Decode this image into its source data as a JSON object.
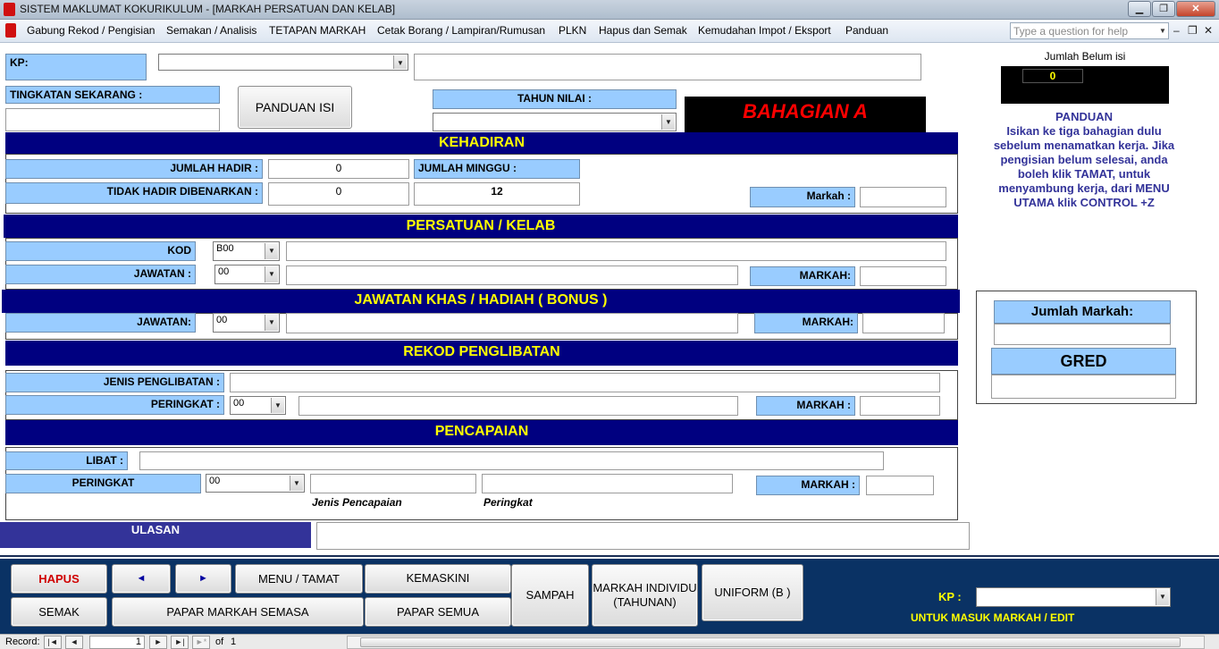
{
  "window": {
    "title": "SISTEM MAKLUMAT KOKURIKULUM - [MARKAH PERSATUAN DAN KELAB]"
  },
  "menu": [
    "Gabung Rekod / Pengisian",
    "Semakan / Analisis",
    "TETAPAN MARKAH",
    "Cetak Borang / Lampiran/Rumusan",
    "PLKN",
    "Hapus dan Semak",
    "Kemudahan Impot / Eksport",
    "Panduan"
  ],
  "help_placeholder": "Type a question for help",
  "header": {
    "kp_label": "KP:",
    "tingkatan_label": "TINGKATAN SEKARANG :",
    "panduan_isi_button": "PANDUAN ISI",
    "tahun_nilai_label": "TAHUN NILAI :",
    "bahagian_banner": "BAHAGIAN A"
  },
  "side": {
    "jumlah_belum_label": "Jumlah Belum isi",
    "jumlah_belum_value": "0",
    "panduan_title": "PANDUAN",
    "panduan_lines": [
      "Isikan ke tiga bahagian dulu",
      "sebelum menamatkan kerja. Jika",
      "pengisian belum selesai, anda",
      "boleh klik TAMAT, untuk",
      "menyambung kerja, dari MENU",
      "UTAMA klik CONTROL +Z"
    ],
    "jumlah_markah_label": "Jumlah Markah:",
    "gred_label": "GRED"
  },
  "kehadiran": {
    "title": "KEHADIRAN",
    "jumlah_hadir_label": "JUMLAH HADIR :",
    "jumlah_hadir_value": "0",
    "jumlah_minggu_label": "JUMLAH MINGGU :",
    "tidak_hadir_label": "TIDAK HADIR DIBENARKAN :",
    "tidak_hadir_value": "0",
    "minggu_value": "12",
    "markah_label": "Markah :"
  },
  "persatuan": {
    "title": "PERSATUAN / KELAB",
    "kod_label": "KOD",
    "kod_value": "B00",
    "jawatan_label": "JAWATAN :",
    "jawatan_value": "00",
    "markah_label": "MARKAH:"
  },
  "jawatan_khas": {
    "title": "JAWATAN KHAS / HADIAH ( BONUS )",
    "jawatan_label": "JAWATAN:",
    "jawatan_value": "00",
    "markah_label": "MARKAH:"
  },
  "penglibatan": {
    "title": "REKOD PENGLIBATAN",
    "jenis_label": "JENIS PENGLIBATAN :",
    "peringkat_label": "PERINGKAT :",
    "peringkat_value": "00",
    "markah_label": "MARKAH :"
  },
  "pencapaian": {
    "title": "PENCAPAIAN",
    "libat_label": "LIBAT :",
    "peringkat_label": "PERINGKAT",
    "peringkat_value": "00",
    "jenis_caption": "Jenis Pencapaian",
    "peringkat_caption": "Peringkat",
    "markah_label": "MARKAH :"
  },
  "ulasan_label": "ULASAN",
  "buttons": {
    "hapus": "HAPUS",
    "prev": "◄",
    "next": "►",
    "menu_tamat": "MENU / TAMAT",
    "kemaskini": "KEMASKINI",
    "sampah": "SAMPAH",
    "markah_individu": "MARKAH INDIVIDU (TAHUNAN)",
    "uniform": "UNIFORM (B )",
    "semak": "SEMAK",
    "papar_markah": "PAPAR MARKAH SEMASA",
    "papar_semua": "PAPAR SEMUA"
  },
  "bottom": {
    "kp_label": "KP :",
    "hint": "UNTUK MASUK MARKAH / EDIT"
  },
  "status": {
    "record_label": "Record:",
    "record_value": "1",
    "of_label": "of",
    "total": "1"
  }
}
